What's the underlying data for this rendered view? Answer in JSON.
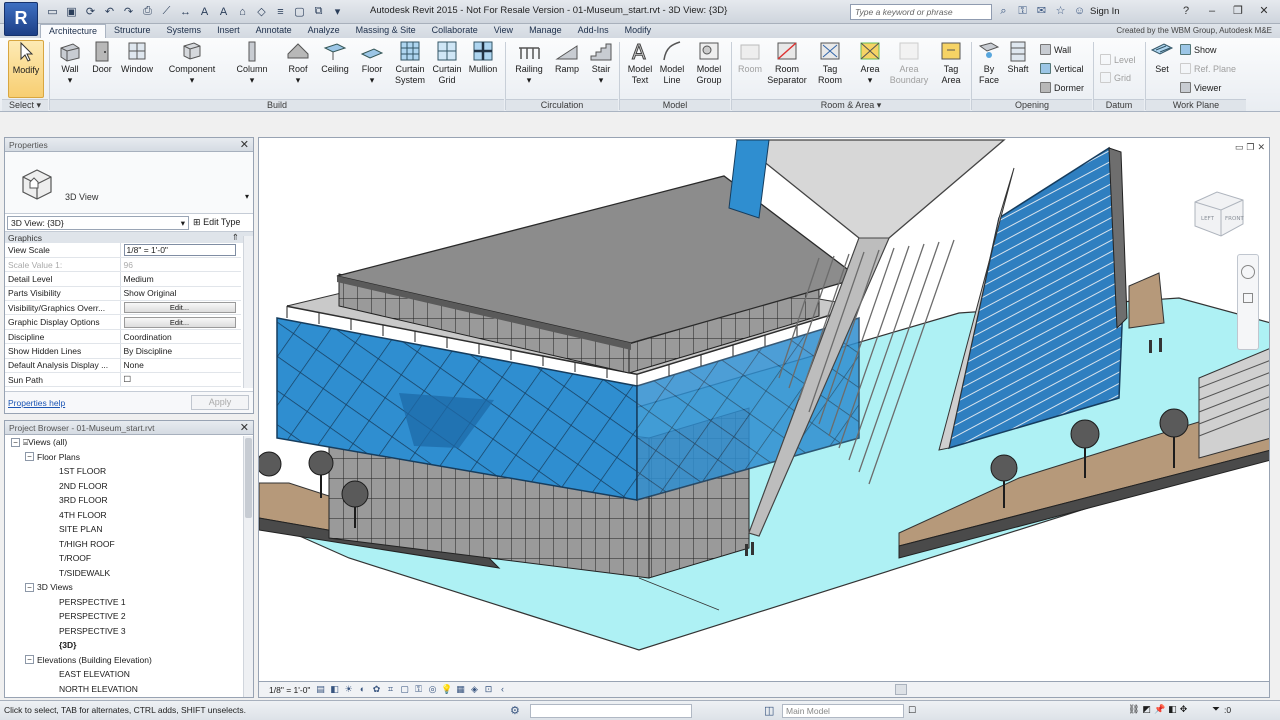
{
  "window": {
    "title": "Autodesk Revit 2015 - Not For Resale Version -   01-Museum_start.rvt - 3D View: {3D}",
    "search_placeholder": "Type a keyword or phrase",
    "sign_in": "Sign In",
    "logo": "R"
  },
  "tabs": [
    {
      "label": "Architecture",
      "active": true
    },
    {
      "label": "Structure"
    },
    {
      "label": "Systems"
    },
    {
      "label": "Insert"
    },
    {
      "label": "Annotate"
    },
    {
      "label": "Analyze"
    },
    {
      "label": "Massing & Site"
    },
    {
      "label": "Collaborate"
    },
    {
      "label": "View"
    },
    {
      "label": "Manage"
    },
    {
      "label": "Add-Ins"
    },
    {
      "label": "Modify"
    }
  ],
  "created_by": "Created by the WBM Group, Autodesk M&E",
  "ribbon": {
    "select": {
      "modify": "Modify",
      "panel": "Select ▾"
    },
    "build": {
      "panel": "Build",
      "wall": "Wall",
      "door": "Door",
      "window": "Window",
      "component": "Component",
      "column": "Column",
      "roof": "Roof",
      "ceiling": "Ceiling",
      "floor": "Floor",
      "curtain_system": "Curtain System",
      "curtain_grid": "Curtain Grid",
      "mullion": "Mullion"
    },
    "circulation": {
      "panel": "Circulation",
      "railing": "Railing",
      "ramp": "Ramp",
      "stair": "Stair"
    },
    "model": {
      "panel": "Model",
      "model_text": "Model Text",
      "model_line": "Model Line",
      "model_group": "Model Group"
    },
    "room_area": {
      "panel": "Room & Area ▾",
      "room": "Room",
      "room_separator": "Room Separator",
      "tag_room": "Tag Room",
      "area": "Area",
      "area_boundary": "Area Boundary",
      "tag_area": "Tag Area"
    },
    "opening": {
      "panel": "Opening",
      "by_face": "By Face",
      "shaft": "Shaft",
      "wall": "Wall",
      "vertical": "Vertical",
      "dormer": "Dormer"
    },
    "datum": {
      "panel": "Datum",
      "level": "Level",
      "grid": "Grid"
    },
    "work_plane": {
      "panel": "Work Plane",
      "set": "Set",
      "show": "Show",
      "ref_plane": "Ref. Plane",
      "viewer": "Viewer"
    }
  },
  "properties": {
    "title": "Properties",
    "type_name": "3D View",
    "instance_selector": "3D View: {3D}",
    "edit_type": "Edit Type",
    "group": "Graphics",
    "rows": [
      {
        "name": "View Scale",
        "value": "1/8\" = 1'-0\"",
        "kind": "input"
      },
      {
        "name": "Scale Value    1:",
        "value": "96",
        "kind": "dim"
      },
      {
        "name": "Detail Level",
        "value": "Medium"
      },
      {
        "name": "Parts Visibility",
        "value": "Show Original"
      },
      {
        "name": "Visibility/Graphics Overr...",
        "value": "Edit...",
        "kind": "button"
      },
      {
        "name": "Graphic Display Options",
        "value": "Edit...",
        "kind": "button"
      },
      {
        "name": "Discipline",
        "value": "Coordination"
      },
      {
        "name": "Show Hidden Lines",
        "value": "By Discipline"
      },
      {
        "name": "Default Analysis Display ...",
        "value": "None"
      },
      {
        "name": "Sun Path",
        "value": "",
        "kind": "checkbox"
      }
    ],
    "help": "Properties help",
    "apply": "Apply"
  },
  "browser": {
    "title": "Project Browser - 01-Museum_start.rvt",
    "tree": [
      {
        "label": "Views (all)",
        "level": 0,
        "toggle": "−"
      },
      {
        "label": "Floor Plans",
        "level": 1,
        "toggle": "−"
      },
      {
        "label": "1ST FLOOR",
        "level": 2
      },
      {
        "label": "2ND FLOOR",
        "level": 2
      },
      {
        "label": "3RD FLOOR",
        "level": 2
      },
      {
        "label": "4TH FLOOR",
        "level": 2
      },
      {
        "label": "SITE PLAN",
        "level": 2
      },
      {
        "label": "T/HIGH ROOF",
        "level": 2
      },
      {
        "label": "T/ROOF",
        "level": 2
      },
      {
        "label": "T/SIDEWALK",
        "level": 2
      },
      {
        "label": "3D Views",
        "level": 1,
        "toggle": "−"
      },
      {
        "label": "PERSPECTIVE 1",
        "level": 2
      },
      {
        "label": "PERSPECTIVE 2",
        "level": 2
      },
      {
        "label": "PERSPECTIVE 3",
        "level": 2
      },
      {
        "label": "{3D}",
        "level": 2,
        "bold": true
      },
      {
        "label": "Elevations (Building Elevation)",
        "level": 1,
        "toggle": "−"
      },
      {
        "label": "EAST ELEVATION",
        "level": 2
      },
      {
        "label": "NORTH ELEVATION",
        "level": 2
      }
    ]
  },
  "viewport": {
    "viewcube_left": "LEFT",
    "viewcube_front": "FRONT"
  },
  "view_control": {
    "scale": "1/8\" = 1'-0\""
  },
  "status": {
    "text": "Click to select, TAB for alternates, CTRL adds, SHIFT unselects.",
    "design_option": "Main Model",
    "filter_count": ":0"
  },
  "colors": {
    "accent": "#3e6fc1",
    "ground": "#aef1f4",
    "glass": "#2f8ed0",
    "roof": "#8c8c8c",
    "deck": "#b6997a"
  }
}
